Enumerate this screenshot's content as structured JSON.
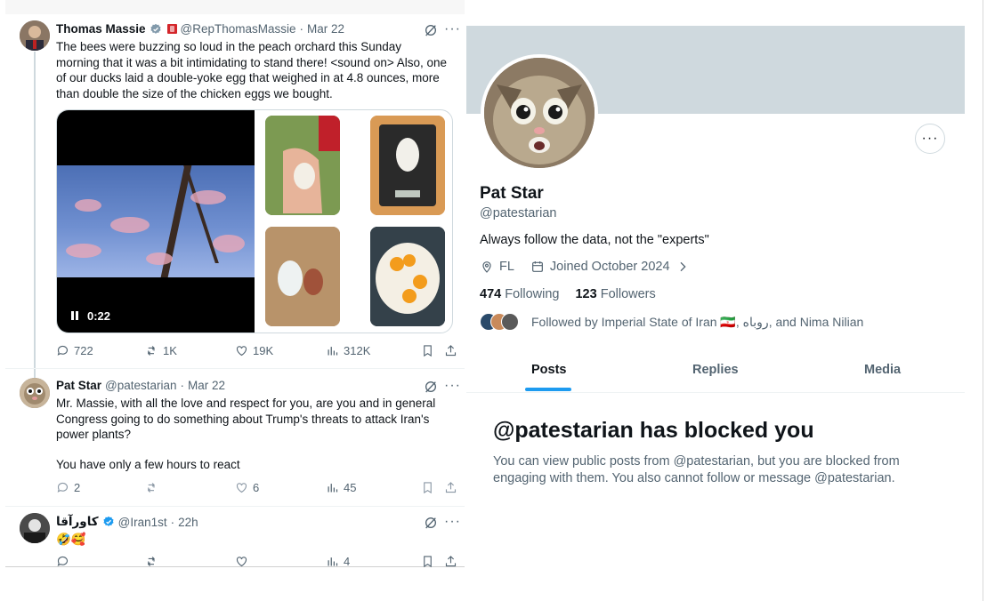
{
  "thread": {
    "tweets": [
      {
        "name": "Thomas Massie",
        "handle": "@RepThomasMassie",
        "sep": "·",
        "time": "Mar 22",
        "text": "The bees were buzzing so loud in the peach orchard this Sunday morning that it was a bit intimidating to stand there! <sound on> Also, one of our ducks laid a double-yoke egg that weighed in at 4.8 ounces, more than double the size of the chicken eggs we bought.",
        "video_time": "0:22",
        "replies": "722",
        "reposts": "1K",
        "likes": "19K",
        "views": "312K"
      },
      {
        "name": "Pat Star",
        "handle": "@patestarian",
        "sep": "·",
        "time": "Mar 22",
        "text1": "Mr. Massie, with all the love and respect for you, are you and in general Congress going to do something about Trump's threats to attack Iran's power plants?",
        "text2": "You have only a few hours to react",
        "replies": "2",
        "reposts": "",
        "likes": "6",
        "views": "45"
      },
      {
        "name": "کاورآقا",
        "handle": "@Iran1st",
        "sep": "·",
        "time": "22h",
        "text": "🤣🥰",
        "replies": "",
        "reposts": "",
        "likes": "",
        "views": "4"
      }
    ]
  },
  "profile": {
    "name": "Pat Star",
    "handle": "@patestarian",
    "bio": "Always follow the data, not the \"experts\"",
    "location": "FL",
    "joined": "Joined October 2024",
    "following_count": "474",
    "following_label": "Following",
    "followers_count": "123",
    "followers_label": "Followers",
    "followed_by": "Followed by Imperial State of Iran 🇮🇷, روباه, and Nima Nilian",
    "more_label": "···",
    "tabs": [
      "Posts",
      "Replies",
      "Media"
    ],
    "blocked_title": "@patestarian has blocked you",
    "blocked_text": "You can view public posts from @patestarian, but you are blocked from engaging with them. You also cannot follow or message @patestarian."
  },
  "colors": {
    "accent": "#1d9bf0",
    "secondary_text": "#536471",
    "banner": "#cfd9de"
  },
  "icons": [
    "verified-icon",
    "grok-icon",
    "more-icon",
    "reply-icon",
    "repost-icon",
    "like-icon",
    "views-icon",
    "bookmark-icon",
    "share-icon",
    "location-icon",
    "calendar-icon",
    "chevron-right-icon",
    "pause-icon"
  ]
}
